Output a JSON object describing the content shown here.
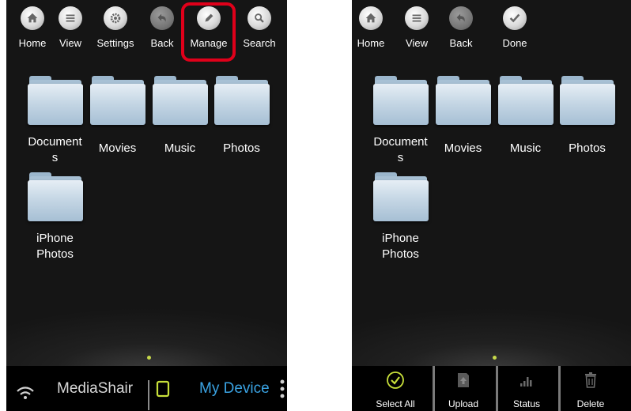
{
  "left_panel": {
    "toolbar": [
      {
        "label": "Home",
        "icon": "home-icon"
      },
      {
        "label": "View",
        "icon": "list-icon"
      },
      {
        "label": "Settings",
        "icon": "gear-icon"
      },
      {
        "label": "Back",
        "icon": "back-arrow-icon"
      },
      {
        "label": "Manage",
        "icon": "pencil-icon"
      },
      {
        "label": "Search",
        "icon": "search-icon"
      }
    ],
    "highlighted_item": "Manage",
    "highlight_color": "#e0001a",
    "folders": [
      {
        "label": "Document\ns"
      },
      {
        "label": "Movies"
      },
      {
        "label": "Music"
      },
      {
        "label": "Photos"
      },
      {
        "label": "iPhone\nPhotos"
      }
    ],
    "bottom_bar": {
      "wifi_tab_label": "MediaShair",
      "device_tab_label": "My Device",
      "active_color": "#3aa3e3",
      "device_icon_color": "#c8e03a"
    }
  },
  "right_panel": {
    "toolbar": [
      {
        "label": "Home",
        "icon": "home-icon"
      },
      {
        "label": "View",
        "icon": "list-icon"
      },
      {
        "label": "Back",
        "icon": "back-arrow-icon"
      },
      {
        "label": "Done",
        "icon": "checkmark-icon"
      }
    ],
    "folders": [
      {
        "label": "Document\ns"
      },
      {
        "label": "Movies"
      },
      {
        "label": "Music"
      },
      {
        "label": "Photos"
      },
      {
        "label": "iPhone\nPhotos"
      }
    ],
    "actions": [
      {
        "label": "Select All",
        "icon": "select-all-icon"
      },
      {
        "label": "Upload",
        "icon": "upload-icon"
      },
      {
        "label": "Status",
        "icon": "status-bars-icon"
      },
      {
        "label": "Delete",
        "icon": "trash-icon"
      }
    ],
    "select_all_color": "#c8e03a"
  }
}
